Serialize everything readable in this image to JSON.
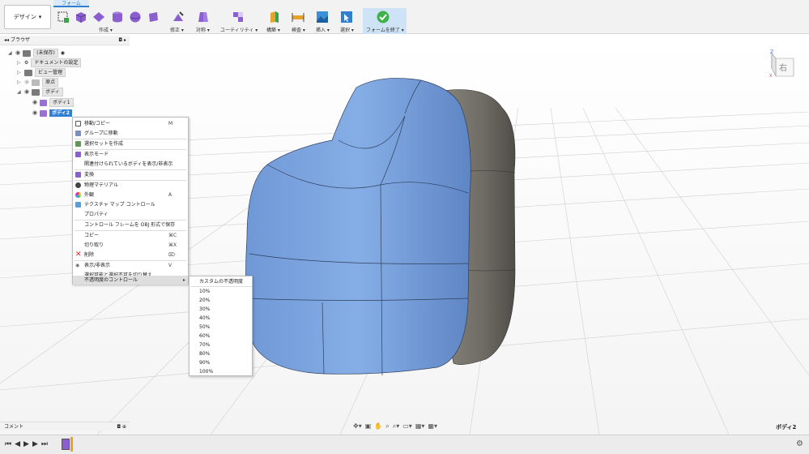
{
  "toolbar": {
    "design_label": "デザイン",
    "tab_label": "フォーム",
    "groups": [
      "作成",
      "修正",
      "対称",
      "ユーティリティ",
      "構築",
      "検査",
      "挿入",
      "選択",
      "フォームを終了"
    ]
  },
  "browser": {
    "title": "ブラウザ",
    "root_label": "(未保存)",
    "items": [
      "ドキュメントの設定",
      "ビュー管理",
      "原点",
      "ボディ",
      "ボディ1",
      "ボディ2"
    ]
  },
  "context_menu": {
    "items": [
      {
        "label": "移動/コピー",
        "shortcut": "M"
      },
      {
        "label": "グループに移動",
        "shortcut": ""
      },
      {
        "label": "選択セットを作成",
        "shortcut": ""
      },
      {
        "label": "表示モード",
        "shortcut": ""
      },
      {
        "label": "関連付けられているボディを表示/非表示",
        "shortcut": ""
      },
      {
        "label": "変換",
        "shortcut": ""
      },
      {
        "label": "物理マテリアル",
        "shortcut": ""
      },
      {
        "label": "外観",
        "shortcut": "A"
      },
      {
        "label": "テクスチャ マップ コントロール",
        "shortcut": ""
      },
      {
        "label": "プロパティ",
        "shortcut": ""
      },
      {
        "label": "コントロール フレームを OBJ 形式で保存",
        "shortcut": ""
      },
      {
        "label": "コピー",
        "shortcut": "⌘C"
      },
      {
        "label": "切り取り",
        "shortcut": "⌘X"
      },
      {
        "label": "削除",
        "shortcut": "⌦"
      },
      {
        "label": "表示/非表示",
        "shortcut": "V"
      },
      {
        "label": "選択可能と選択不可を切り替え",
        "shortcut": ""
      },
      {
        "label": "不透明度のコントロール",
        "shortcut": ""
      }
    ]
  },
  "opacity_submenu": [
    "カスタムの不透明度",
    "10%",
    "20%",
    "30%",
    "40%",
    "50%",
    "60%",
    "70%",
    "80%",
    "90%",
    "100%"
  ],
  "viewcube": {
    "face": "右",
    "axis_z": "Z",
    "axis_x": "X"
  },
  "comments": {
    "title": "コメント"
  },
  "status": {
    "selection": "ボディ2"
  },
  "colors": {
    "accent": "#2f80d1",
    "body_blue": "#7ea6e0",
    "body_gray": "#6e6b64"
  }
}
